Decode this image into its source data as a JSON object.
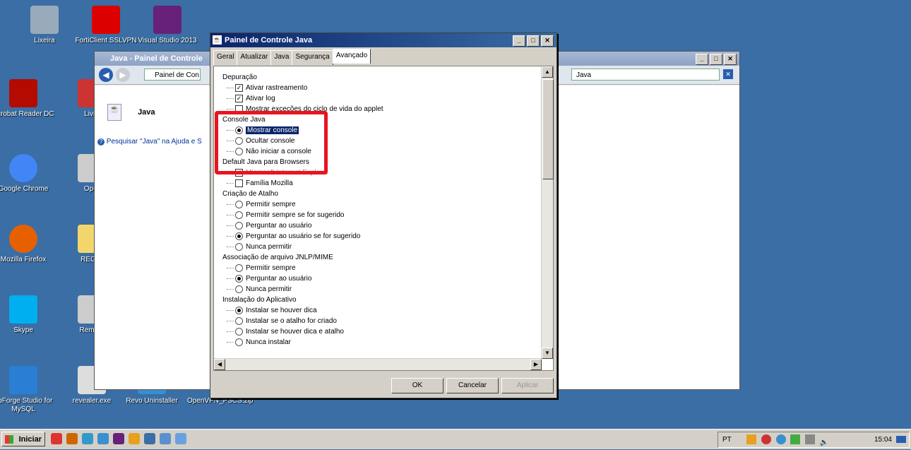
{
  "desktop": {
    "icons": [
      {
        "label": "Lixeira",
        "icon": "recycle-bin-icon",
        "color": "#9ab"
      },
      {
        "label": "FortiClient SSLVPN",
        "icon": "forticlient-icon",
        "color": "#d00"
      },
      {
        "label": "Visual Studio 2013",
        "icon": "visual-studio-icon",
        "color": "#68217a"
      },
      {
        "label": "Acrobat Reader DC",
        "icon": "acrobat-icon",
        "color": "#b30b00"
      },
      {
        "label": "Livro",
        "icon": "shortcut-icon",
        "color": "#c33"
      },
      {
        "label": "Google Chrome",
        "icon": "chrome-icon",
        "color": "#4285f4"
      },
      {
        "label": "Oper",
        "icon": "shortcut-icon",
        "color": "#ccc"
      },
      {
        "label": "Mozilla Firefox",
        "icon": "firefox-icon",
        "color": "#e66000"
      },
      {
        "label": "REGIN",
        "icon": "folder-icon",
        "color": "#f3d66b"
      },
      {
        "label": "Skype",
        "icon": "skype-icon",
        "color": "#00aff0"
      },
      {
        "label": "Remote",
        "icon": "shortcut-icon",
        "color": "#ccc"
      },
      {
        "label": "dbForge Studio for MySQL",
        "icon": "dbforge-icon",
        "color": "#2a7fd4"
      },
      {
        "label": "revealer.exe",
        "icon": "revealer-icon",
        "color": "#ddd"
      },
      {
        "label": "Revo Uninstaller",
        "icon": "revo-icon",
        "color": "#3a8fd0"
      },
      {
        "label": "OpenVPN_PSCS.zip",
        "icon": "zip-icon",
        "color": "#3a6ea5"
      }
    ]
  },
  "explorer": {
    "title": "Java - Painel de Controle",
    "address": "Painel de Con",
    "search_value": "Java",
    "item_label": "Java",
    "help_link": "Pesquisar \"Java\" na Ajuda e S"
  },
  "dialog": {
    "title": "Painel de Controle Java",
    "tabs": [
      "Geral",
      "Atualizar",
      "Java",
      "Segurança",
      "Avançado"
    ],
    "active_tab": "Avançado",
    "rows": [
      {
        "type": "hd",
        "text": "Depuração"
      },
      {
        "type": "cb",
        "text": "Ativar rastreamento",
        "checked": true
      },
      {
        "type": "cb",
        "text": "Ativar log",
        "checked": true
      },
      {
        "type": "cb",
        "text": "Mostrar exceções do ciclo de vida do applet",
        "checked": false
      },
      {
        "type": "hd",
        "text": "Console Java"
      },
      {
        "type": "rb",
        "text": "Mostrar console",
        "checked": true,
        "selected": true
      },
      {
        "type": "rb",
        "text": "Ocultar console",
        "checked": false
      },
      {
        "type": "rb",
        "text": "Não iniciar a console",
        "checked": false
      },
      {
        "type": "hd",
        "text": "Default Java para Browsers"
      },
      {
        "type": "cb",
        "text": "Microsoft Internet Explorer",
        "checked": true,
        "disabled": true
      },
      {
        "type": "cb",
        "text": "Família Mozilla",
        "checked": false
      },
      {
        "type": "hd",
        "text": "Criação de Atalho"
      },
      {
        "type": "rb",
        "text": "Permitir sempre",
        "checked": false
      },
      {
        "type": "rb",
        "text": "Permitir sempre se for sugerido",
        "checked": false
      },
      {
        "type": "rb",
        "text": "Perguntar ao usuário",
        "checked": false
      },
      {
        "type": "rb",
        "text": "Perguntar ao usuário se for sugerido",
        "checked": true
      },
      {
        "type": "rb",
        "text": "Nunca permitir",
        "checked": false
      },
      {
        "type": "hd",
        "text": "Associação de arquivo JNLP/MIME"
      },
      {
        "type": "rb",
        "text": "Permitir sempre",
        "checked": false
      },
      {
        "type": "rb",
        "text": "Perguntar ao usuário",
        "checked": true
      },
      {
        "type": "rb",
        "text": "Nunca permitir",
        "checked": false
      },
      {
        "type": "hd",
        "text": "Instalação do Aplicativo"
      },
      {
        "type": "rb",
        "text": "Instalar se houver dica",
        "checked": true
      },
      {
        "type": "rb",
        "text": "Instalar se o atalho for criado",
        "checked": false
      },
      {
        "type": "rb",
        "text": "Instalar se houver dica e atalho",
        "checked": false
      },
      {
        "type": "rb",
        "text": "Nunca instalar",
        "checked": false
      }
    ],
    "buttons": {
      "ok": "OK",
      "cancel": "Cancelar",
      "apply": "Aplicar"
    }
  },
  "taskbar": {
    "start_label": "Iniciar",
    "lang": "PT",
    "clock": "15:04"
  }
}
